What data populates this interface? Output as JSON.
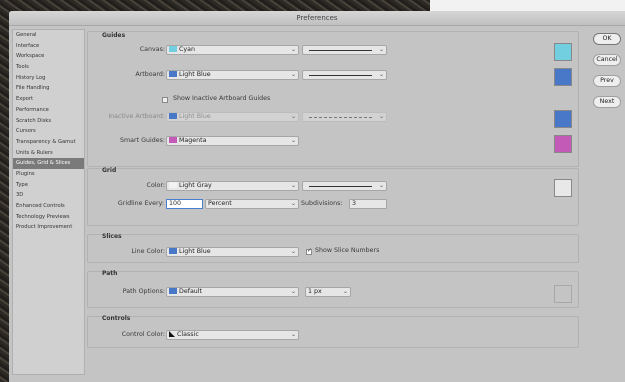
{
  "window": {
    "title": "Preferences"
  },
  "sidebar": {
    "items": [
      {
        "label": "General"
      },
      {
        "label": "Interface"
      },
      {
        "label": "Workspace"
      },
      {
        "label": "Tools"
      },
      {
        "label": "History Log"
      },
      {
        "label": "File Handling"
      },
      {
        "label": "Export"
      },
      {
        "label": "Performance"
      },
      {
        "label": "Scratch Disks"
      },
      {
        "label": "Cursors"
      },
      {
        "label": "Transparency & Gamut"
      },
      {
        "label": "Units & Rulers"
      },
      {
        "label": "Guides, Grid & Slices"
      },
      {
        "label": "Plugins"
      },
      {
        "label": "Type"
      },
      {
        "label": "3D"
      },
      {
        "label": "Enhanced Controls"
      },
      {
        "label": "Technology Previews"
      },
      {
        "label": "Product Improvement"
      }
    ],
    "active_index": 12
  },
  "guides": {
    "title": "Guides",
    "canvas_label": "Canvas:",
    "canvas_value": "Cyan",
    "canvas_color": "#72cfe0",
    "artboard_label": "Artboard:",
    "artboard_value": "Light Blue",
    "artboard_color": "#4a78c8",
    "show_inactive_label": "Show Inactive Artboard Guides",
    "show_inactive_checked": false,
    "inactive_label": "Inactive Artboard:",
    "inactive_value": "Light Blue",
    "inactive_color": "#4a78c8",
    "smart_label": "Smart Guides:",
    "smart_value": "Magenta",
    "smart_color": "#c45ab8"
  },
  "grid": {
    "title": "Grid",
    "color_label": "Color:",
    "color_value": "Light Gray",
    "color_swatch": "#e8e8e8",
    "gridline_label": "Gridline Every:",
    "gridline_value": "100",
    "unit_value": "Percent",
    "subdivisions_label": "Subdivisions:",
    "subdivisions_value": "3"
  },
  "slices": {
    "title": "Slices",
    "line_color_label": "Line Color:",
    "line_color_value": "Light Blue",
    "line_color": "#4a78c8",
    "show_numbers_label": "Show Slice Numbers",
    "show_numbers_checked": true
  },
  "path": {
    "title": "Path",
    "options_label": "Path Options:",
    "options_value": "Default",
    "options_color": "#4a78c8",
    "width_value": "1 px"
  },
  "controls": {
    "title": "Controls",
    "control_color_label": "Control Color:",
    "control_color_value": "Classic"
  },
  "buttons": {
    "ok": "OK",
    "cancel": "Cancel",
    "prev": "Prev",
    "next": "Next"
  }
}
